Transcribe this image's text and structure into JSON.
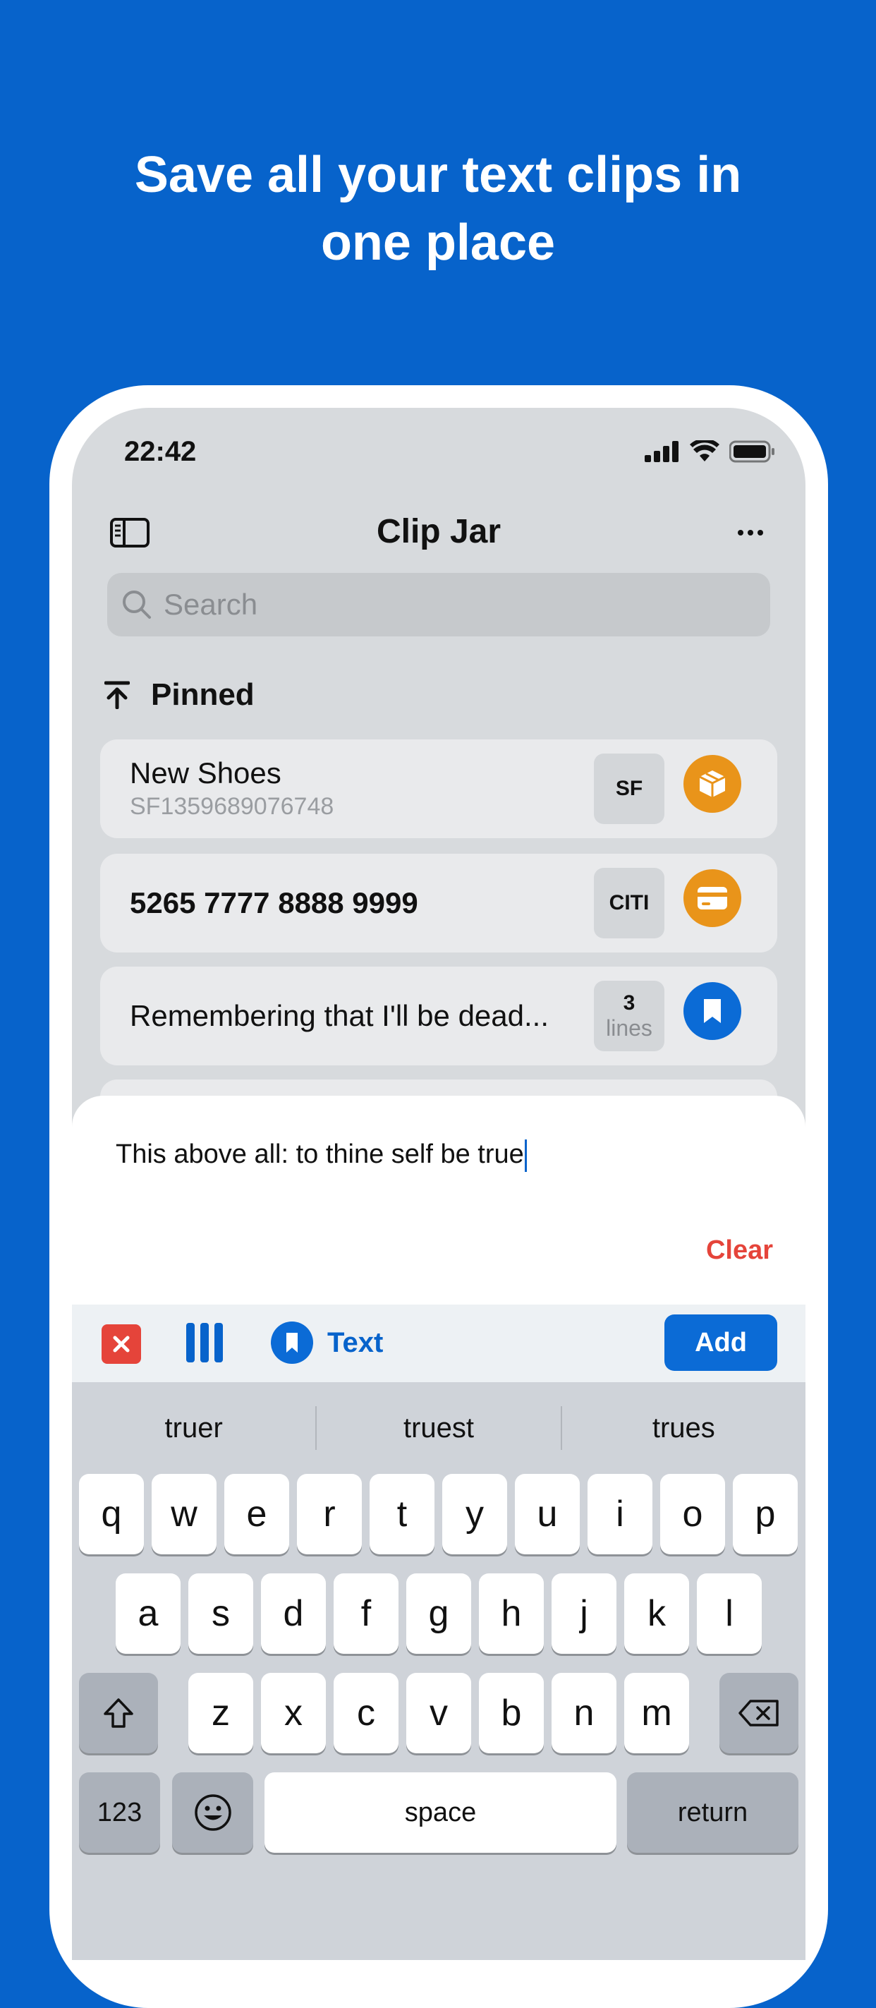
{
  "hero": {
    "line1": "Save all your text clips in",
    "line2": "one place"
  },
  "status": {
    "time": "22:42"
  },
  "nav": {
    "title": "Clip Jar"
  },
  "search": {
    "placeholder": "Search"
  },
  "section": {
    "title": "Pinned"
  },
  "clips": [
    {
      "title": "New Shoes",
      "subtitle": "SF1359689076748",
      "tag": "SF",
      "icon": "package-icon",
      "color": "#E9941A"
    },
    {
      "title": "5265 7777 8888 9999",
      "tag": "CITI",
      "icon": "credit-card-icon",
      "color": "#E9941A"
    },
    {
      "title": "Remembering that I'll be dead...",
      "tag": "3",
      "tag_sub": "lines",
      "icon": "bookmark-icon",
      "color": "#0B6BD6"
    }
  ],
  "editor": {
    "text": "This above all: to thine self be true",
    "clear_label": "Clear"
  },
  "toolbar": {
    "type_label": "Text",
    "add_label": "Add"
  },
  "keyboard": {
    "suggestions": [
      "truer",
      "truest",
      "trues"
    ],
    "row1": [
      "q",
      "w",
      "e",
      "r",
      "t",
      "y",
      "u",
      "i",
      "o",
      "p"
    ],
    "row2": [
      "a",
      "s",
      "d",
      "f",
      "g",
      "h",
      "j",
      "k",
      "l"
    ],
    "row3": [
      "z",
      "x",
      "c",
      "v",
      "b",
      "n",
      "m"
    ],
    "numbers_label": "123",
    "space_label": "space",
    "return_label": "return"
  },
  "colors": {
    "background": "#0763CB",
    "accent": "#0B6BD6",
    "danger": "#E5443A",
    "orange": "#E9941A"
  }
}
